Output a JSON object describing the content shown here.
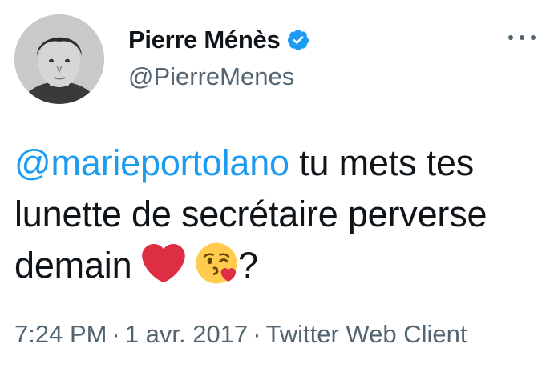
{
  "author": {
    "display_name": "Pierre Ménès",
    "handle": "@PierreMenes",
    "verified_icon": "verified-badge-icon",
    "avatar_icon": "avatar-photo"
  },
  "tweet": {
    "mention": "@marieportolano",
    "text_part1": " tu mets tes lunette de secrétaire perverse demain ",
    "emoji1": "red-heart-emoji",
    "emoji2": "face-blowing-kiss-emoji",
    "text_end": "?"
  },
  "meta": {
    "time": "7:24 PM",
    "separator": "·",
    "date": "1 avr. 2017",
    "client": "Twitter Web Client"
  },
  "more_menu_icon": "more-dots-icon",
  "colors": {
    "link": "#1d9bf0",
    "secondary_text": "#536471",
    "primary_text": "#0f1419",
    "verified": "#1d9bf0"
  }
}
